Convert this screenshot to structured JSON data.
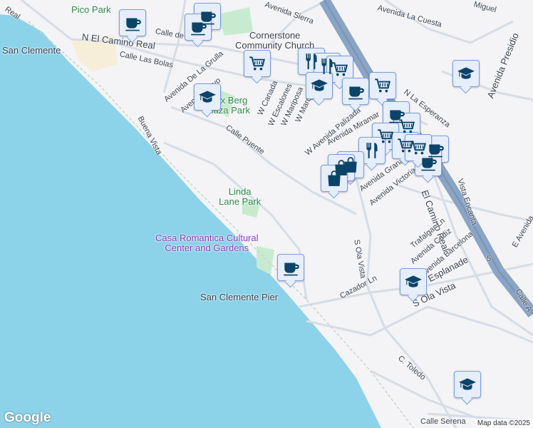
{
  "map": {
    "colors": {
      "water": "#8cd3ea",
      "land": "#f4f3f5",
      "road": "#d6dde6",
      "highway": "#8aa4c4",
      "park": "#c8ebd0",
      "marker_fill": "#e6edfb",
      "marker_border": "#7c9fe0",
      "icon": "#0b4468"
    },
    "labels": {
      "pico_park": "Pico Park",
      "n_el_camino_real": "N El Camino Real",
      "camino_real_nw": "Real",
      "san_clemente": "San Clemente",
      "calle_las_bolas": "Calle Las Bolas",
      "calle_de": "Calle de",
      "avenida_de_la_grulla": "Avenida De La Grulla",
      "avenida_mayo": "Avenida Mayo",
      "max_berg": "Max Berg\nPlaza Park",
      "buena_vista": "Buena Vista",
      "calle_puente": "Calle Puente",
      "cornerstone": "Cornerstone\nCommunity Church",
      "avenida_sierra": "Avenida Sierra",
      "avenida_la_cuesta": "Avenida La Cuesta",
      "miguel": "Miguel",
      "avenida_presidio": "Avenida Presidio",
      "n_la_esperanza": "N La Esperanza",
      "w_canada": "W Canada",
      "w_escalones": "W Escalones",
      "w_mariposa": "W Mariposa",
      "w_marquita": "W Marquita",
      "w_avenida_palizada": "W Avenida Palizada",
      "avenida_miramar": "Avenida Miramar",
      "avenida_granada": "Avenida Granada",
      "avenida_victoria": "Avenida Victoria",
      "el_camino_real": "El Camino Real",
      "vista_encanta": "Vista Encanta",
      "e_avenida": "E Avenida",
      "linda_lane": "Linda\nLane Park",
      "casa_romantica": "Casa Romantica Cultural\nCenter and Gardens",
      "s_ola_vista": "S Ola Vista",
      "s_ola_vista_2": "S Ola Vista",
      "trafalgar": "Trafalgar Ln",
      "avenida_cadiz": "Avenida Cadiz",
      "avenida_barcelona": "Avenida Barcelona",
      "esplanade": "Esplanade",
      "san_clemente_pier": "San Clemente Pier",
      "cazador": "Cazador Ln",
      "c_toledo": "C. Toledo",
      "calle_serena": "Calle Serena",
      "calle_a": "Calle A",
      "i5": "5"
    },
    "markers": [
      "coffee",
      "coffee",
      "coffee",
      "cart",
      "graduation",
      "fork",
      "fork",
      "cart",
      "graduation",
      "coffee",
      "cart",
      "coffee",
      "cart",
      "cart",
      "cart",
      "fork",
      "shopping-bag",
      "shopping-bag",
      "shopping-bag",
      "coffee",
      "coffee",
      "cart",
      "coffee",
      "graduation",
      "graduation",
      "graduation"
    ],
    "google": "Google",
    "attribution": "Map data ©2025"
  }
}
